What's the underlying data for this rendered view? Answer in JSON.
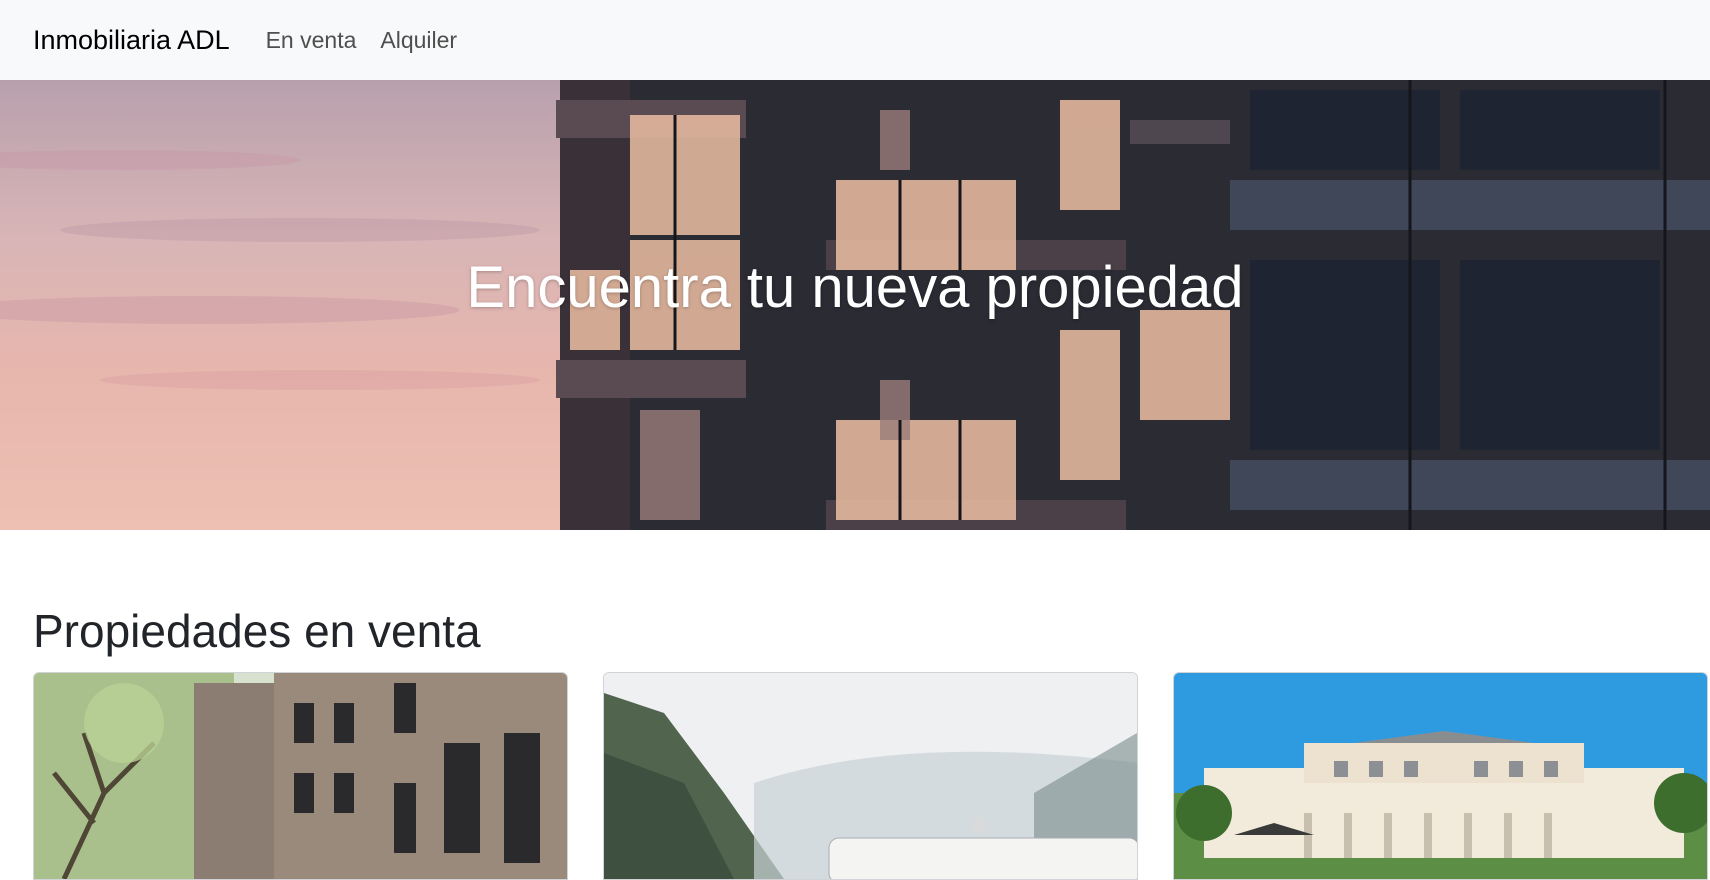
{
  "navbar": {
    "brand": "Inmobiliaria ADL",
    "links": [
      {
        "label": "En venta"
      },
      {
        "label": "Alquiler"
      }
    ]
  },
  "hero": {
    "title": "Encuentra tu nueva propiedad",
    "image": "apartment-building-sunset"
  },
  "section": {
    "title": "Propiedades en venta"
  },
  "properties": [
    {
      "image": "brownstone-townhouses"
    },
    {
      "image": "camper-van-fjord"
    },
    {
      "image": "luxury-mansion"
    }
  ]
}
